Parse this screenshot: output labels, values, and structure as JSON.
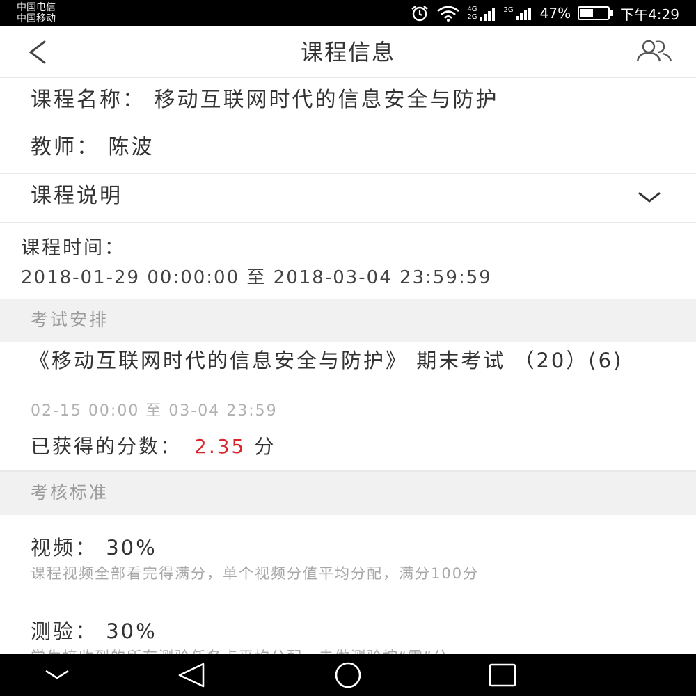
{
  "status": {
    "carrier1": "中国电信",
    "carrier2": "中国移动",
    "net1": "4G",
    "net2": "2G",
    "net3": "2G",
    "battery_percent": "47%",
    "battery_level": 0.47,
    "time": "下午4:29"
  },
  "header": {
    "title": "课程信息"
  },
  "course": {
    "name": "课程名称： 移动互联网时代的信息安全与防护",
    "teacher": "教师： 陈波",
    "description_label": "课程说明",
    "time_label": "课程时间：",
    "time_range": "2018-01-29 00:00:00 至 2018-03-04 23:59:59"
  },
  "exam_section": {
    "title": "考试安排",
    "exam_title": "《移动互联网时代的信息安全与防护》 期末考试 （20）(6)",
    "exam_time": "02-15 00:00 至 03-04 23:59",
    "score_label": "已获得的分数：",
    "score_value": "2.35",
    "score_unit": "分"
  },
  "criteria_section": {
    "title": "考核标准",
    "items": [
      {
        "name": "视频： 30%",
        "desc": "课程视频全部看完得满分，单个视频分值平均分配，满分100分"
      },
      {
        "name": "测验： 30%",
        "desc": "学生接收到的所有测验任务点平均分配，未做测验按“零”分"
      }
    ]
  },
  "colors": {
    "score_red": "#d9262c",
    "section_bg": "#f1f1f1",
    "muted_text": "#9a9a9a"
  }
}
